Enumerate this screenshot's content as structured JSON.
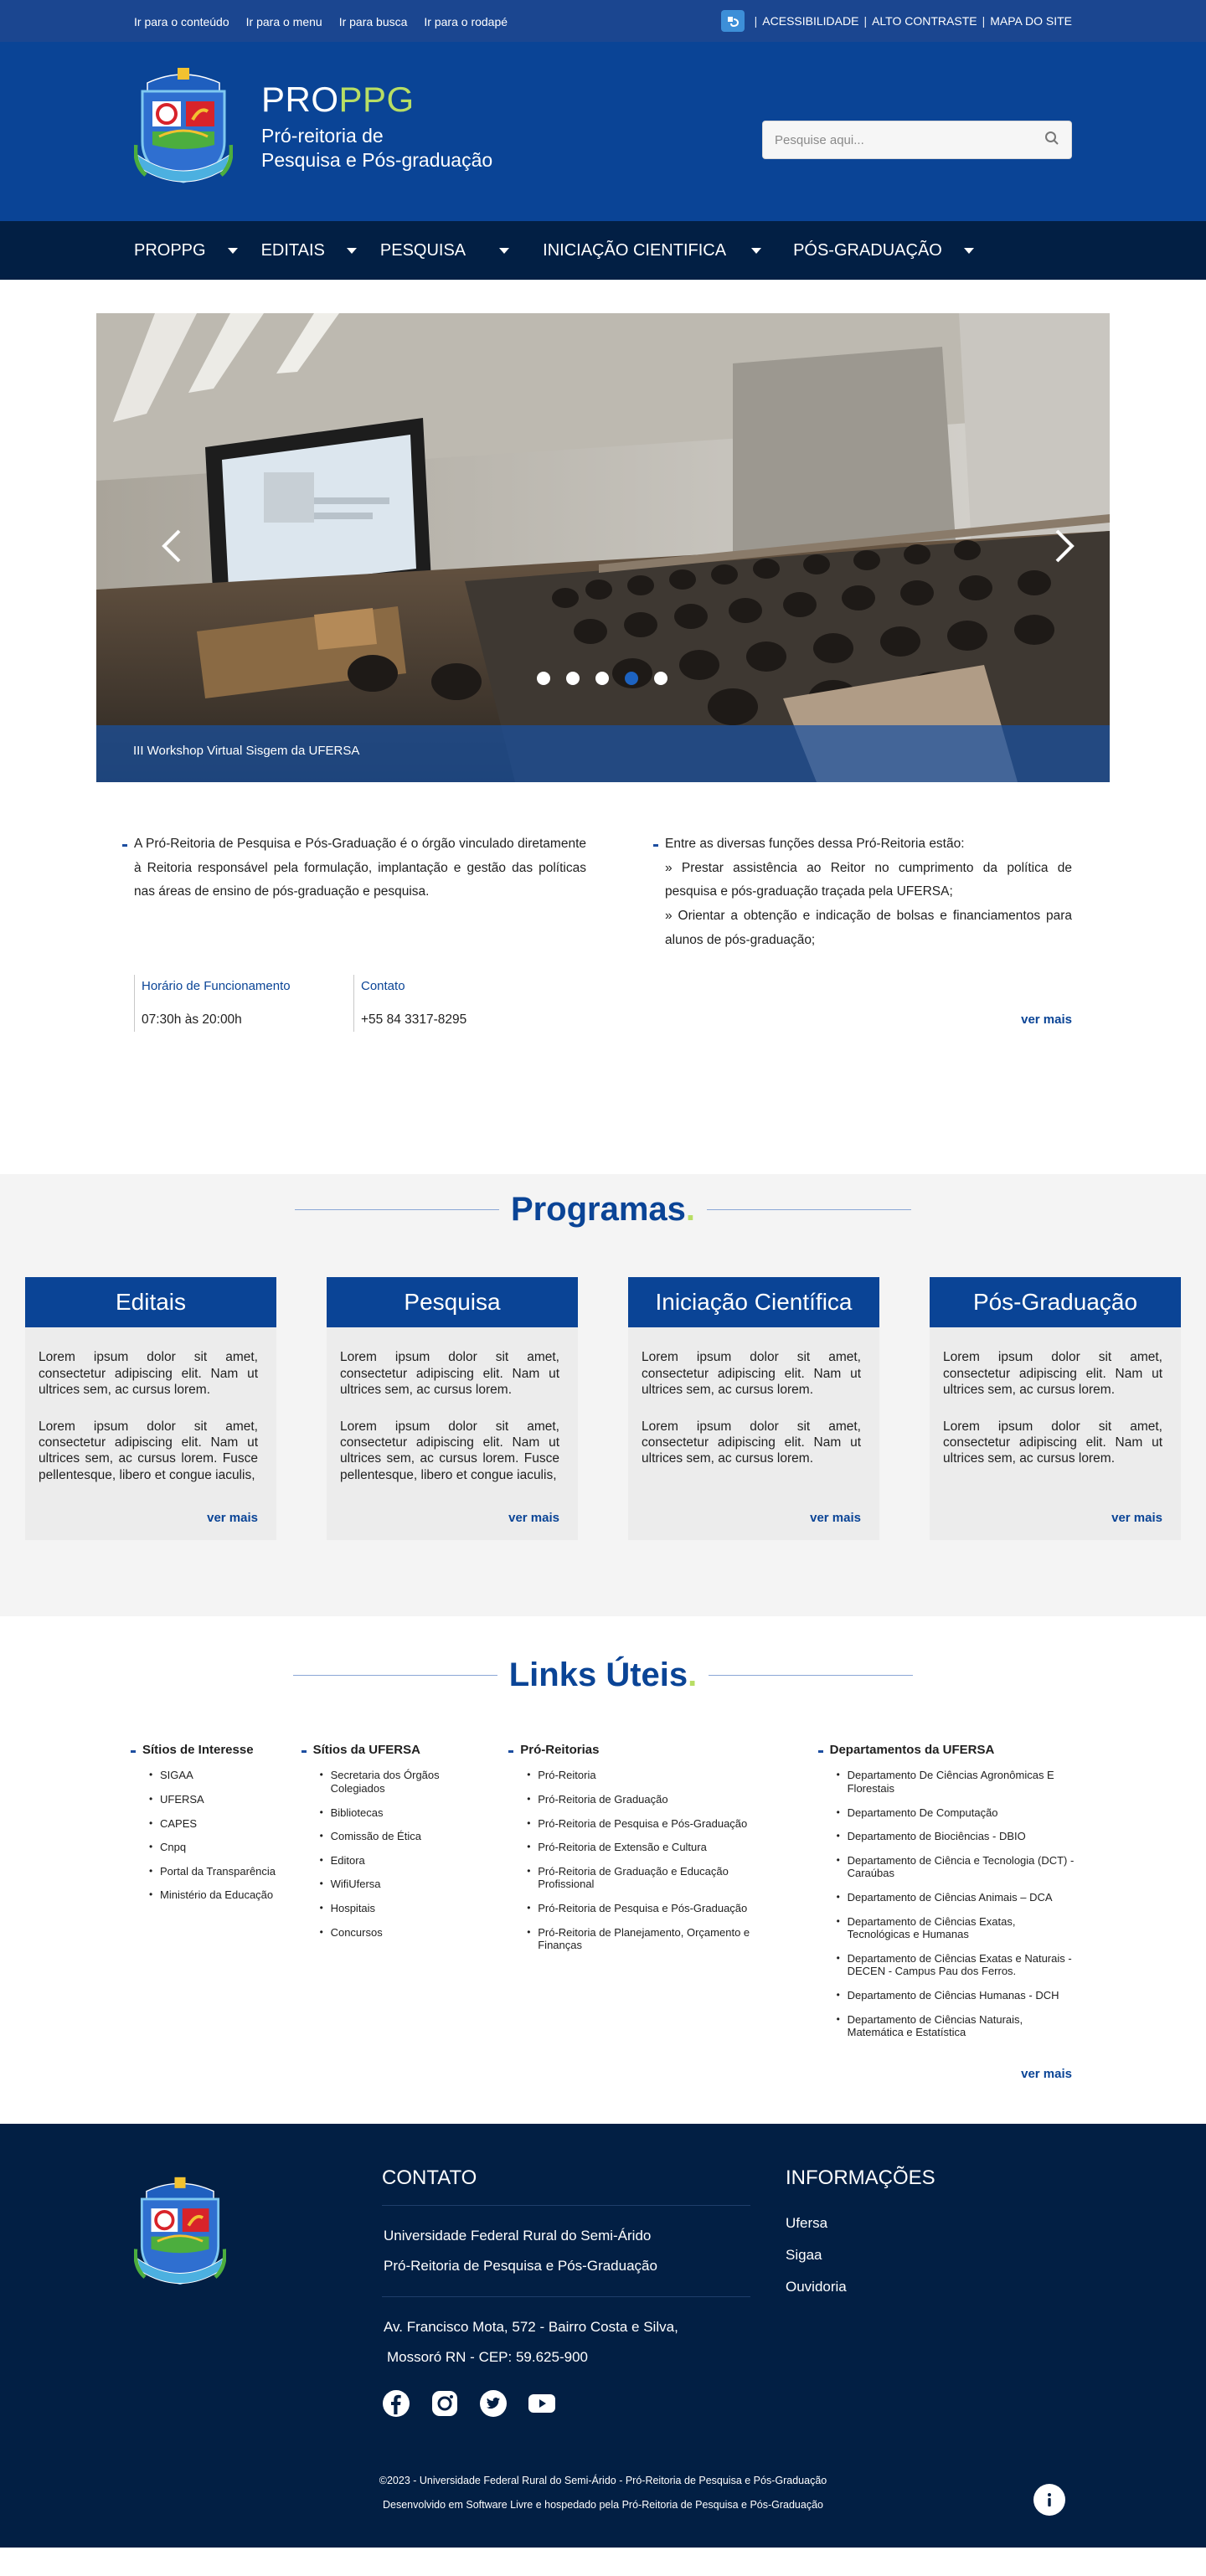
{
  "topbar": {
    "skip_links": [
      "Ir para o conteúdo",
      "Ir para o menu",
      "Ir para busca",
      "Ir para o rodapé"
    ],
    "accessibility": "ACESSIBILIDADE",
    "contrast": "ALTO CONTRASTE",
    "sitemap": "MAPA DO SITE",
    "separator": "|"
  },
  "header": {
    "brand_pro": "PRO",
    "brand_ppg": "PPG",
    "subtitle_line1": "Pró-reitoria de",
    "subtitle_line2": "Pesquisa e Pós-graduação",
    "search_placeholder": "Pesquise aqui..."
  },
  "nav": {
    "items": [
      "PROPPG",
      "EDITAIS",
      "PESQUISA",
      "INICIAÇÃO CIENTIFICA",
      "PÓS-GRADUAÇÃO"
    ]
  },
  "carousel": {
    "caption": "III Workshop Virtual Sisgem da UFERSA",
    "slide_count": 5,
    "active_index": 3
  },
  "intro": {
    "description": "A Pró-Reitoria de Pesquisa e Pós-Graduação é o órgão vinculado diretamente à Reitoria responsável pela formulação, implantação e gestão das políticas nas áreas de ensino de pós-graduação e pesquisa.",
    "hours_label": "Horário de Funcionamento",
    "hours_value": "07:30h às 20:00h",
    "contact_label": "Contato",
    "contact_value": "+55 84 3317-8295",
    "functions_title": "Entre as diversas funções dessa Pró-Reitoria estão:",
    "functions": [
      "» Prestar assistência ao Reitor no cumprimento da política de pesquisa e pós-graduação traçada pela UFERSA;",
      "» Orientar a obtenção e indicação de bolsas e financiamentos para alunos de pós-graduação;"
    ],
    "see_more": "ver mais"
  },
  "programs": {
    "title": "Programas",
    "title_dot": ".",
    "cards": [
      {
        "title": "Editais",
        "p1": "Lorem ipsum dolor sit amet, consectetur adipiscing elit. Nam ut ultrices sem, ac cursus lorem.",
        "p2": "Lorem ipsum dolor sit amet, consectetur adipiscing elit. Nam ut ultrices sem, ac cursus lorem. Fusce pellentesque, libero et congue iaculis,",
        "more": "ver mais"
      },
      {
        "title": "Pesquisa",
        "p1": "Lorem ipsum dolor sit amet, consectetur adipiscing elit. Nam ut ultrices sem, ac cursus lorem.",
        "p2": "Lorem ipsum dolor sit amet, consectetur adipiscing elit. Nam ut ultrices sem, ac cursus lorem. Fusce pellentesque, libero et congue iaculis,",
        "more": "ver mais"
      },
      {
        "title": "Iniciação Científica",
        "p1": "Lorem ipsum dolor sit amet, consectetur adipiscing elit. Nam ut ultrices sem, ac cursus lorem.",
        "p2": "Lorem ipsum dolor sit amet, consectetur adipiscing elit. Nam ut ultrices sem, ac cursus lorem.",
        "more": "ver mais"
      },
      {
        "title": "Pós-Graduação",
        "p1": "Lorem ipsum dolor sit amet, consectetur adipiscing elit. Nam ut ultrices sem, ac cursus lorem.",
        "p2": "Lorem ipsum dolor sit amet, consectetur adipiscing elit. Nam ut ultrices sem, ac cursus lorem.",
        "more": "ver mais"
      }
    ]
  },
  "links": {
    "title": "Links Úteis",
    "title_dot": ".",
    "columns": [
      {
        "title": "Sítios de Interesse",
        "items": [
          "SIGAA",
          "UFERSA",
          "CAPES",
          "Cnpq",
          "Portal da Transparência",
          "Ministério da Educação"
        ]
      },
      {
        "title": "Sítios da UFERSA",
        "items": [
          "Secretaria dos Órgãos Colegiados",
          "Bibliotecas",
          "Comissão de Ética",
          "Editora",
          "WifiUfersa",
          "Hospitais",
          "Concursos"
        ]
      },
      {
        "title": "Pró-Reitorias",
        "items": [
          "Pró-Reitoria",
          "Pró-Reitoria de Graduação",
          "Pró-Reitoria de Pesquisa e Pós-Graduação",
          "Pró-Reitoria de Extensão e Cultura",
          "Pró-Reitoria de Graduação e Educação Profissional",
          "Pró-Reitoria de Pesquisa e Pós-Graduação",
          "Pró-Reitoria de Planejamento, Orçamento e Finanças"
        ]
      },
      {
        "title": "Departamentos da UFERSA",
        "items": [
          "Departamento De Ciências Agronômicas E Florestais",
          "Departamento De Computação",
          "Departamento de Biociências - DBIO",
          "Departamento de Ciência e Tecnologia (DCT) - Caraúbas",
          "Departamento de Ciências Animais – DCA",
          "Departamento de Ciências Exatas, Tecnológicas e Humanas",
          "Departamento de Ciências Exatas e Naturais - DECEN - Campus Pau dos Ferros.",
          "Departamento de Ciências Humanas - DCH",
          "Departamento de Ciências Naturais, Matemática e Estatística"
        ]
      }
    ],
    "see_more": "ver mais"
  },
  "footer": {
    "contact_title": "CONTATO",
    "org1": "Universidade Federal Rural do Semi-Árido",
    "org2": "Pró-Reitoria de Pesquisa e Pós-Graduação",
    "address1": "Av. Francisco Mota, 572 - Bairro Costa e Silva,",
    "address2": "Mossoró RN - CEP: 59.625-900",
    "info_title": "INFORMAÇÕES",
    "info_links": [
      "Ufersa",
      "Sigaa",
      "Ouvidoria"
    ],
    "copyright": "©2023 - Universidade Federal Rural do Semi-Árido - Pró-Reitoria de Pesquisa e Pós-Graduação",
    "credits": "Desenvolvido em Software Livre e hospedado pela Pró-Reitoria de Pesquisa e Pós-Graduação",
    "social_icons": [
      "facebook-icon",
      "instagram-icon",
      "twitter-icon",
      "youtube-icon"
    ]
  },
  "colors": {
    "primary": "#0a4496",
    "dark_navy": "#021f44",
    "accent_green": "#b8de64",
    "topbar": "#1b4690"
  }
}
